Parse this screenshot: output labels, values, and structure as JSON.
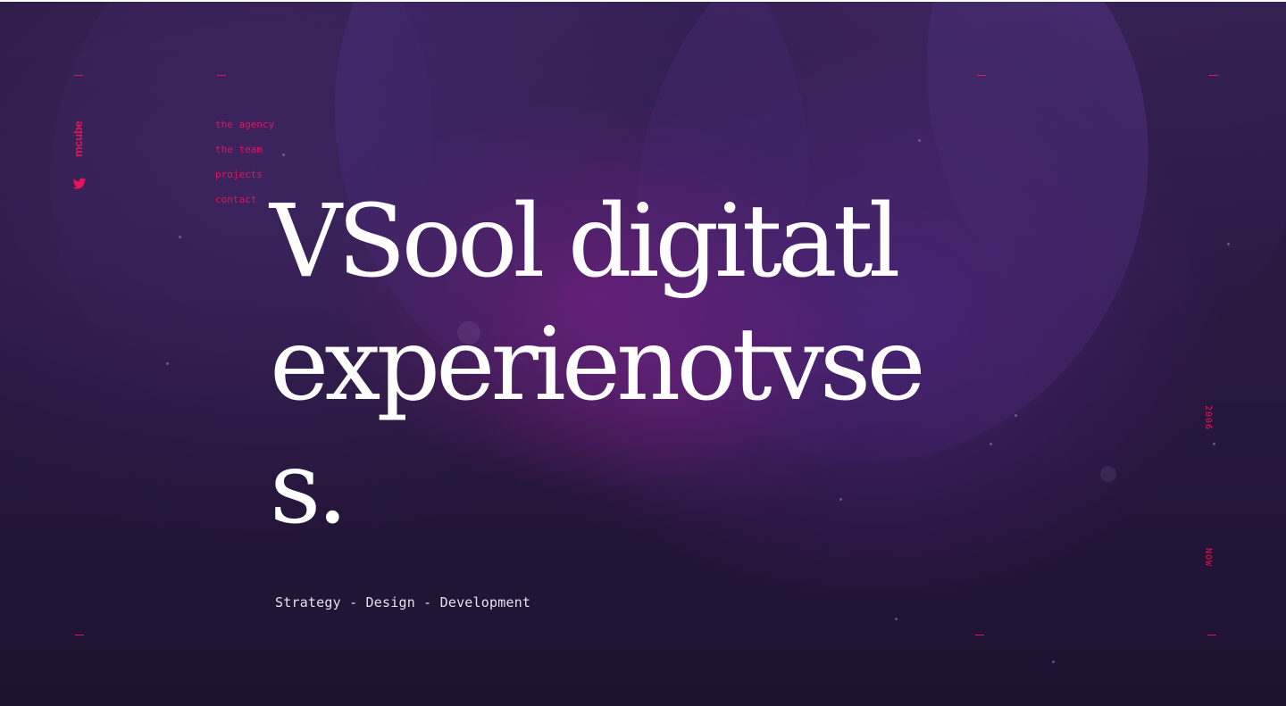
{
  "brand": {
    "logo_text": "mcube",
    "twitter_icon": "twitter-bird-icon",
    "accent_color": "#e8125a"
  },
  "nav": {
    "items": [
      {
        "label": "the agency"
      },
      {
        "label": "the team"
      },
      {
        "label": "projects"
      },
      {
        "label": "contact"
      }
    ]
  },
  "hero": {
    "headline_lines": [
      "VSool digitatl",
      "experienotvse",
      "s."
    ],
    "tagline": "Strategy - Design - Development"
  },
  "timeline": {
    "start_label": "2006",
    "end_label": "NOW"
  }
}
